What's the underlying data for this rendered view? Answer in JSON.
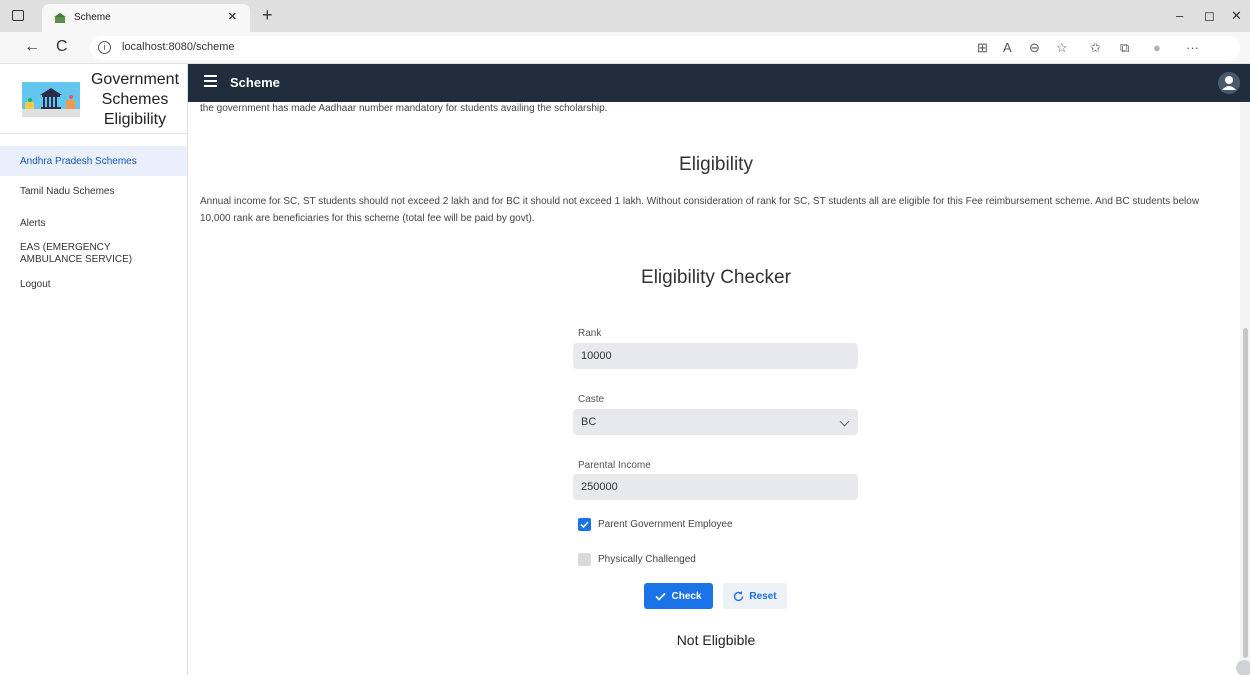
{
  "browser": {
    "tab_title": "Scheme",
    "tab_close": "×",
    "new_tab": "+",
    "url": "localhost:8080/scheme",
    "back": "←",
    "refresh": "C",
    "info": "i",
    "minimize": "–",
    "restore": "◻",
    "close": "✕",
    "toolbar_icons": [
      "⊞",
      "A",
      "⊖",
      "☆",
      "✩",
      "⧉",
      "●",
      "···"
    ]
  },
  "sidebar": {
    "brand_lines": [
      "Government",
      "Schemes",
      "Eligibility"
    ],
    "items": [
      {
        "label": "Andhra Pradesh Schemes"
      },
      {
        "label": "Tamil Nadu Schemes"
      },
      {
        "label": "Alerts"
      },
      {
        "label": "EAS (EMERGENCY AMBULANCE SERVICE)"
      },
      {
        "label": "Logout"
      }
    ]
  },
  "topbar": {
    "title": "Scheme"
  },
  "main": {
    "intro_text": "the government has made Aadhaar number mandatory for students availing the scholarship.",
    "eligibility_heading": "Eligibility",
    "eligibility_text": "Annual income for SC, ST students should not exceed 2 lakh and for BC it should not exceed 1 lakh. Without consideration of rank for SC, ST students all are eligible for this Fee reimbursement scheme. And BC students below 10,000 rank are beneficiaries for this scheme (total fee will be paid by govt).",
    "checker_heading": "Eligibility Checker"
  },
  "form": {
    "rank_label": "Rank",
    "rank_value": "10000",
    "caste_label": "Caste",
    "caste_value": "BC",
    "income_label": "Parental Income",
    "income_value": "250000",
    "parent_gov_label": "Parent Government Employee",
    "parent_gov_checked": true,
    "physically_label": "Physically Challenged",
    "physically_checked": false,
    "check_button": "Check",
    "reset_button": "Reset",
    "result": "Not Eligbible"
  },
  "colors": {
    "topbar": "#1f2d3d",
    "accent": "#1a73e8",
    "active_nav_bg": "#e9f0fb",
    "field_bg": "#e8e9ed"
  }
}
